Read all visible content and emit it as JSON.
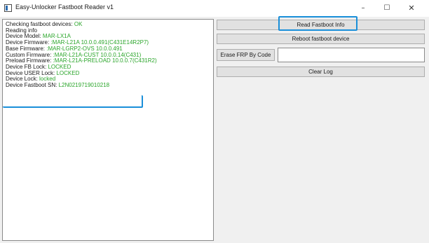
{
  "window": {
    "title": "Easy-Unlocker Fastboot Reader v1",
    "minimize_glyph": "–",
    "maximize_glyph": "☐",
    "close_glyph": "✕"
  },
  "log": {
    "lines": [
      {
        "label": "Checking fastboot devices: ",
        "value": "OK"
      },
      {
        "label": "Reading info",
        "value": ""
      },
      {
        "label": "Device Model: ",
        "value": "MAR-LX1A"
      },
      {
        "label": "Device Firmware: ",
        "value": ":MAR-L21A 10.0.0.491(C431E14R2P7)"
      },
      {
        "label": "Base Firmware: ",
        "value": ":MAR-LGRP2-OVS 10.0.0.491"
      },
      {
        "label": "Custom Firmware: ",
        "value": ":MAR-L21A-CUST 10.0.0.14(C431)"
      },
      {
        "label": "Preload Firmware: ",
        "value": ":MAR-L21A-PRELOAD 10.0.0.7(C431R2)"
      },
      {
        "label": "Device FB Lock: ",
        "value": "LOCKED"
      },
      {
        "label": "Device USER Lock: ",
        "value": "LOCKED"
      },
      {
        "label": "Device Lock: ",
        "value": "locked"
      },
      {
        "label": "Device Fastboot SN: ",
        "value": "L2N0219719010218"
      }
    ]
  },
  "actions": {
    "read_label": "Read Fastboot Info",
    "reboot_label": "Reboot fastboot device",
    "erase_label": "Erase FRP By Code",
    "code_value": "",
    "clear_label": "Clear Log"
  },
  "colors": {
    "value_text": "#2aa52a",
    "highlight": "#1a8fd9"
  }
}
